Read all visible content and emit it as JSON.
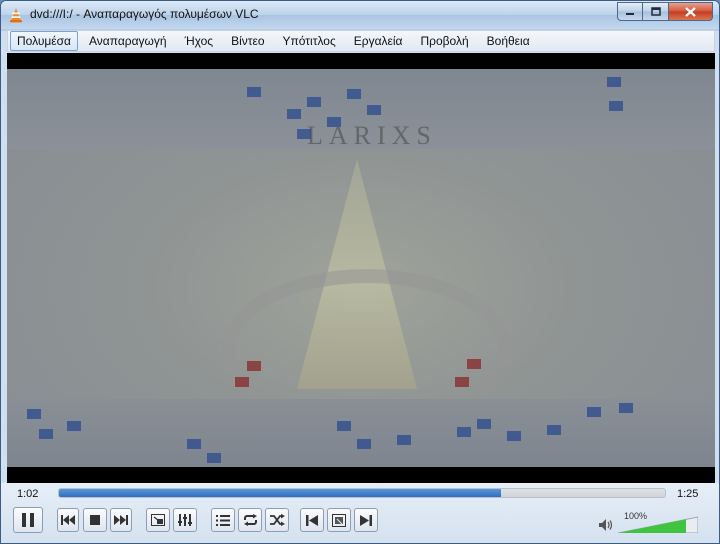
{
  "window": {
    "title": "dvd:///I:/ - Αναπαραγωγός πολυμέσων VLC",
    "app_icon": "vlc-cone-icon"
  },
  "menu": [
    {
      "label": "Πολυμέσα",
      "active": true
    },
    {
      "label": "Αναπαραγωγή"
    },
    {
      "label": "Ήχος"
    },
    {
      "label": "Βίντεο"
    },
    {
      "label": "Υπότιτλος"
    },
    {
      "label": "Εργαλεία"
    },
    {
      "label": "Προβολή"
    },
    {
      "label": "Βοήθεια"
    }
  ],
  "video": {
    "watermark": "LARIXS"
  },
  "playback": {
    "elapsed": "1:02",
    "total": "1:25",
    "progress": 0.73
  },
  "volume": {
    "label": "100%",
    "level": 0.85
  },
  "buttons": [
    {
      "name": "pause-button",
      "icon": "pause-icon"
    },
    {
      "name": "previous-button",
      "icon": "skip-previous-icon"
    },
    {
      "name": "stop-button",
      "icon": "stop-icon"
    },
    {
      "name": "next-button",
      "icon": "skip-next-icon"
    },
    {
      "name": "fullscreen-button",
      "icon": "fullscreen-icon"
    },
    {
      "name": "extended-settings-button",
      "icon": "equalizer-icon"
    },
    {
      "name": "playlist-button",
      "icon": "playlist-icon"
    },
    {
      "name": "loop-button",
      "icon": "loop-icon"
    },
    {
      "name": "shuffle-button",
      "icon": "shuffle-icon"
    },
    {
      "name": "frame-previous-button",
      "icon": "frame-previous-icon"
    },
    {
      "name": "snapshot-button",
      "icon": "record-icon"
    },
    {
      "name": "frame-next-button",
      "icon": "frame-next-icon"
    }
  ],
  "colors": {
    "seek_fill": "#2f6fbf",
    "volume_fill": "#3fc43f",
    "close_button": "#c23b1f"
  }
}
